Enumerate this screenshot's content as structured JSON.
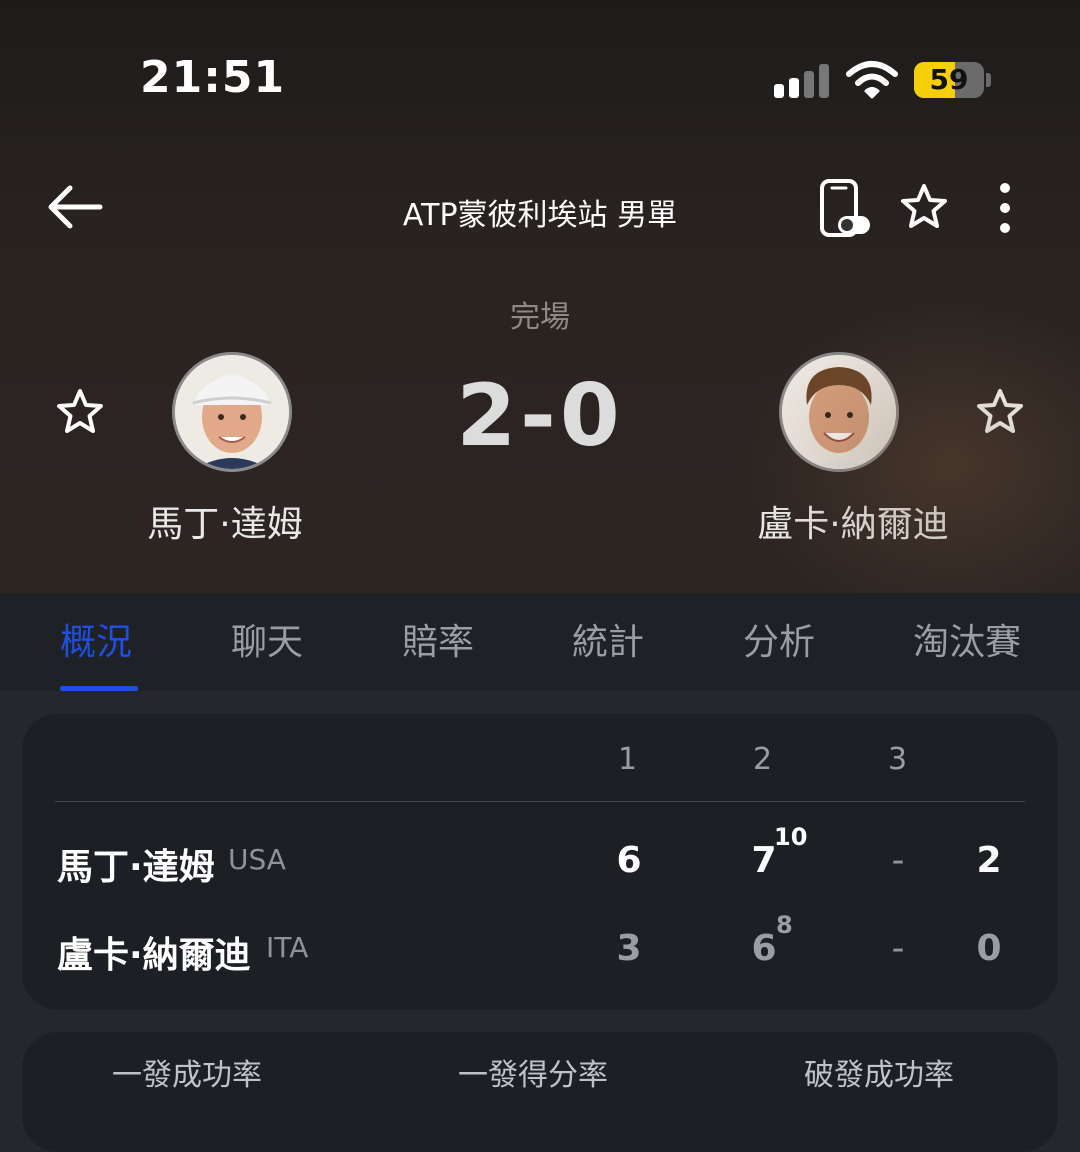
{
  "status_bar": {
    "time": "21:51",
    "battery": "59",
    "battery_level_percent": 59
  },
  "header": {
    "title": "ATP蒙彼利埃站 男單",
    "match_status": "完場",
    "score": "2-0",
    "player_left": {
      "name": "馬丁·達姆"
    },
    "player_right": {
      "name": "盧卡·納爾迪"
    }
  },
  "tabs": [
    "概況",
    "聊天",
    "賠率",
    "統計",
    "分析",
    "淘汰賽"
  ],
  "active_tab": "概況",
  "scoreboard": {
    "set_headers": [
      "1",
      "2",
      "3"
    ],
    "rows": [
      {
        "name": "馬丁·達姆",
        "country": "USA",
        "sets": [
          "6",
          "7",
          "-"
        ],
        "tiebreak": "10",
        "total": "2"
      },
      {
        "name": "盧卡·納爾迪",
        "country": "ITA",
        "sets": [
          "3",
          "6",
          "-"
        ],
        "tiebreak": "8",
        "total": "0"
      }
    ]
  },
  "stats_labels": [
    "一發成功率",
    "一發得分率",
    "破發成功率"
  ],
  "colors": {
    "accent": "#1f4ee0",
    "battery": "#f5cf0a",
    "background": "#24272c",
    "card": "#1c1f23"
  }
}
